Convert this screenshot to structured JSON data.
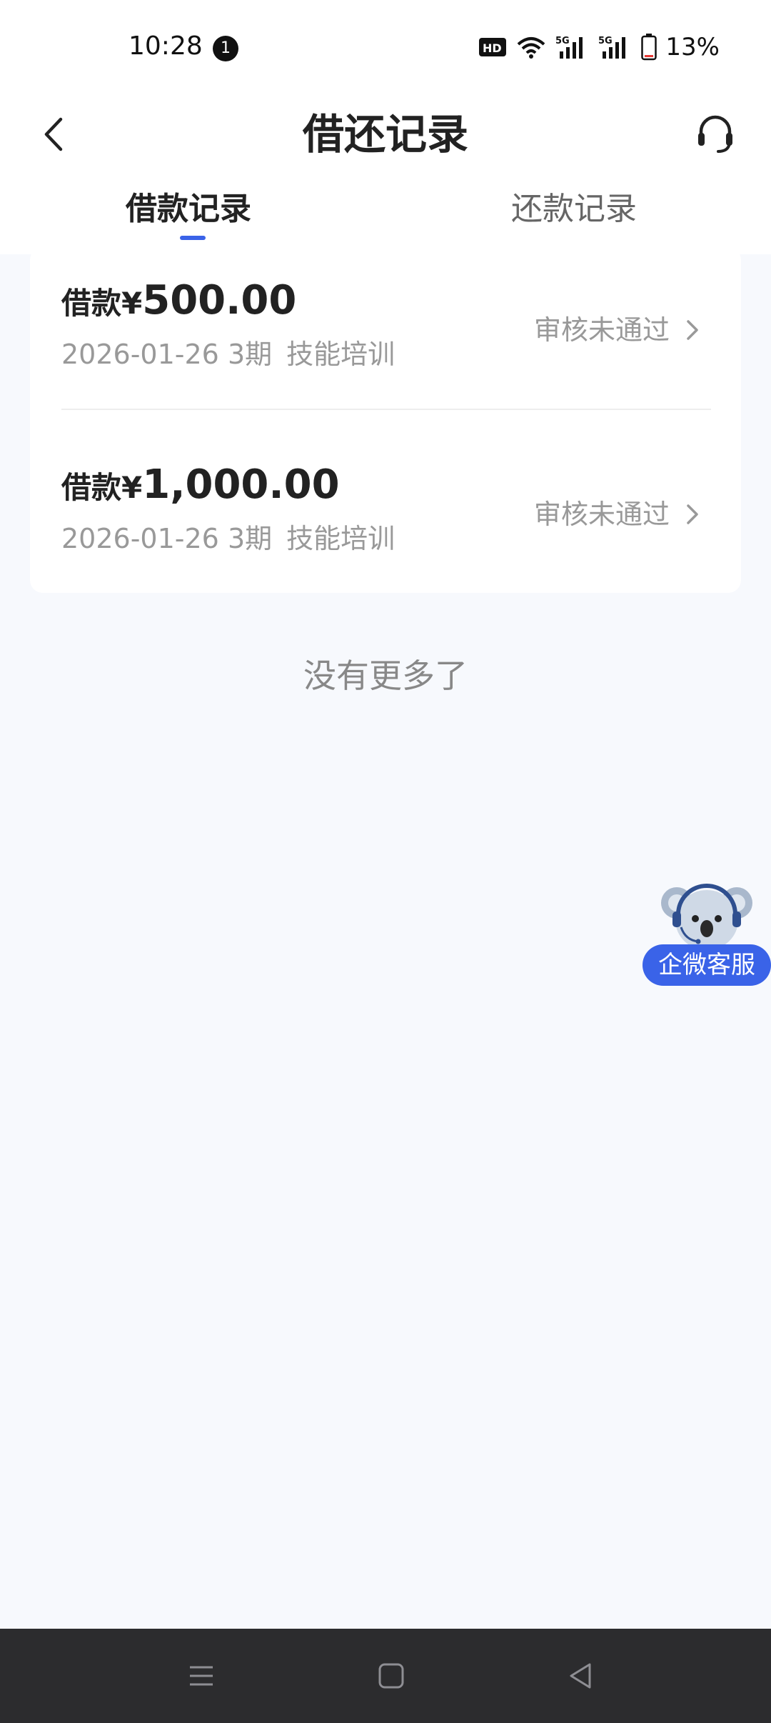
{
  "status_bar": {
    "time": "10:28",
    "notification_count": "1",
    "battery": "13%",
    "icons": [
      "hd-icon",
      "wifi-icon",
      "signal-5g-icon",
      "signal-5g-icon",
      "battery-icon"
    ]
  },
  "header": {
    "title": "借还记录",
    "back_icon": "chevron-left-icon",
    "support_icon": "headset-icon"
  },
  "tabs": [
    {
      "label": "借款记录",
      "active": true
    },
    {
      "label": "还款记录",
      "active": false
    }
  ],
  "records": [
    {
      "prefix": "借款¥",
      "amount": "500.00",
      "date": "2026-01-26",
      "term": "3期",
      "purpose": "技能培训",
      "status": "审核未通过"
    },
    {
      "prefix": "借款¥",
      "amount": "1,000.00",
      "date": "2026-01-26",
      "term": "3期",
      "purpose": "技能培训",
      "status": "审核未通过"
    }
  ],
  "footer_text": "没有更多了",
  "floating_support": {
    "label": "企微客服"
  },
  "colors": {
    "accent": "#3a63e8",
    "background": "#f7f9fd",
    "muted_text": "#999999",
    "navbar": "#2c2c2e"
  }
}
